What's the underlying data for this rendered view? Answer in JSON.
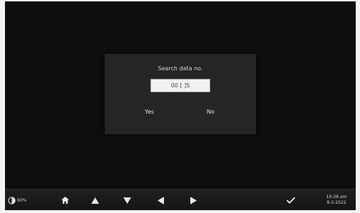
{
  "dialog": {
    "title": "Search data no.",
    "input_value": "00 [ ]5",
    "yes_label": "Yes",
    "no_label": "No"
  },
  "toolbar": {
    "brightness": "60%",
    "icons": [
      "brightness-icon",
      "home-icon",
      "arrow-up-icon",
      "arrow-down-icon",
      "arrow-left-icon",
      "arrow-right-icon",
      "check-icon"
    ],
    "time": "10:38 am",
    "date": "8-2-2022"
  },
  "colors": {
    "screen_background": "#0e0e0e",
    "dialog_background": "#252525",
    "toolbar_background": "#1a1a1a",
    "text": "#e6e6e6"
  }
}
